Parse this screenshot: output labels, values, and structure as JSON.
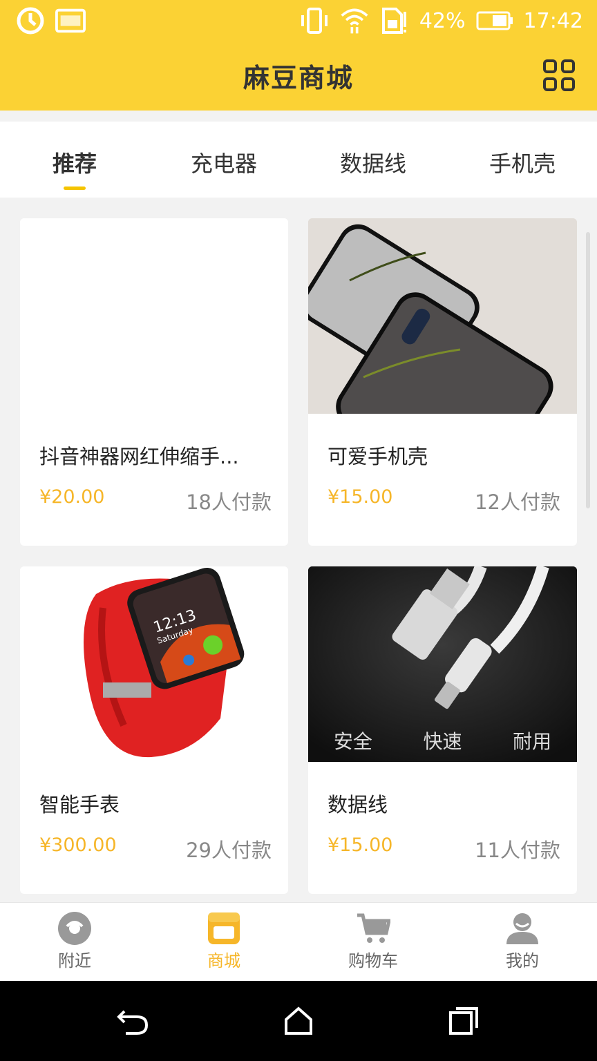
{
  "status_bar": {
    "battery": "42%",
    "time": "17:42"
  },
  "header": {
    "title": "麻豆商城"
  },
  "tabs": [
    {
      "label": "推荐",
      "active": true
    },
    {
      "label": "充电器",
      "active": false
    },
    {
      "label": "数据线",
      "active": false
    },
    {
      "label": "手机壳",
      "active": false
    }
  ],
  "products": [
    {
      "name": "抖音神器网红伸缩手...",
      "price": "¥20.00",
      "paid": "18人付款"
    },
    {
      "name": "可爱手机壳",
      "price": "¥15.00",
      "paid": "12人付款"
    },
    {
      "name": "智能手表",
      "price": "¥300.00",
      "paid": "29人付款",
      "watch_time": "12:13",
      "watch_day": "Saturday"
    },
    {
      "name": "数据线",
      "price": "¥15.00",
      "paid": "11人付款",
      "banner": [
        "安全",
        "快速",
        "耐用"
      ]
    }
  ],
  "bottom_nav": [
    {
      "label": "附近",
      "active": false
    },
    {
      "label": "商城",
      "active": true
    },
    {
      "label": "购物车",
      "active": false
    },
    {
      "label": "我的",
      "active": false
    }
  ],
  "colors": {
    "accent": "#fbd234",
    "price": "#f6b629"
  }
}
